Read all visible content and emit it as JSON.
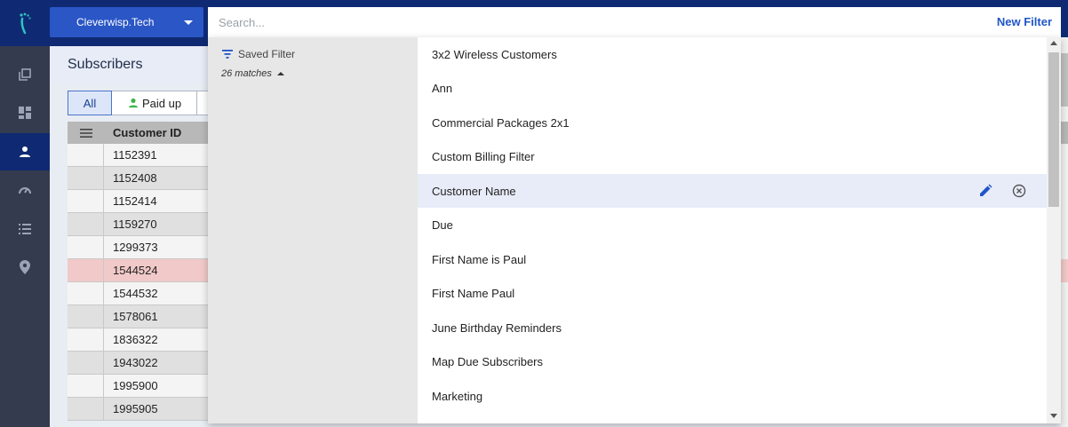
{
  "colors": {
    "topbar": "#0f2a73",
    "accent": "#2a56c6",
    "link": "#1f55c8",
    "nav_bg": "#343b4e",
    "flag_row": "#f1c9c9"
  },
  "header": {
    "org_name": "Cleverwisp.Tech",
    "search_placeholder": "Search...",
    "new_filter_label": "New Filter"
  },
  "nav": {
    "items": [
      {
        "icon": "copy-icon",
        "active": false
      },
      {
        "icon": "dashboard-icon",
        "active": false
      },
      {
        "icon": "person-icon",
        "active": true
      },
      {
        "icon": "speed-icon",
        "active": false
      },
      {
        "icon": "list-icon",
        "active": false
      },
      {
        "icon": "location-pin-icon",
        "active": false
      }
    ]
  },
  "page": {
    "title": "Subscribers",
    "chips": [
      {
        "label": "All",
        "active": true
      },
      {
        "label": "Paid up",
        "active": false,
        "icon": "person-icon"
      }
    ],
    "grid": {
      "column_header": "Customer ID",
      "rows": [
        "1152391",
        "1152408",
        "1152414",
        "1159270",
        "1299373",
        "1544524",
        "1544532",
        "1578061",
        "1836322",
        "1943022",
        "1995900",
        "1995905"
      ]
    }
  },
  "dropdown": {
    "saved_filter_label": "Saved Filter",
    "matches_label": "26 matches",
    "items": [
      "3x2 Wireless Customers",
      "Ann",
      "Commercial Packages 2x1",
      "Custom Billing Filter",
      "Customer Name",
      "Due",
      "First Name is Paul",
      "First Name Paul",
      "June Birthday Reminders",
      "Map Due Subscribers",
      "Marketing"
    ],
    "hovered_index": 4
  }
}
